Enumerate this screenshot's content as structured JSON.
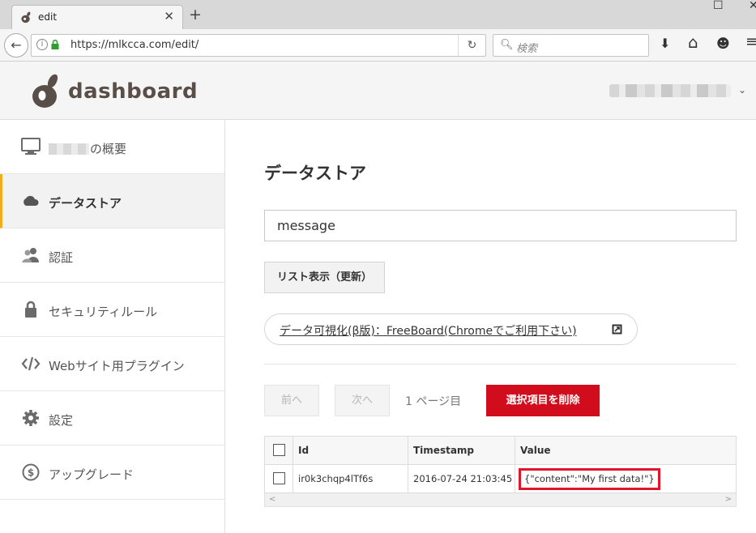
{
  "browser": {
    "tab_title": "edit",
    "tab_close": "✕",
    "new_tab": "+",
    "back": "←",
    "info": "i",
    "url": "https://mlkcca.com/edit/",
    "reload": "↻",
    "search_icon": "🔍︎",
    "search_placeholder": "検索",
    "download_icon": "⬇",
    "home_icon": "⌂",
    "emoji_icon": "☻",
    "menu_icon": "≡",
    "maximize": "☐",
    "close": "✕"
  },
  "header": {
    "brand": "dashboard",
    "account_caret": "⌄"
  },
  "sidebar": {
    "items": [
      {
        "label": "の概要",
        "icon": "monitor-icon"
      },
      {
        "label": "データストア",
        "icon": "cloud-icon"
      },
      {
        "label": "認証",
        "icon": "users-icon"
      },
      {
        "label": "セキュリティルール",
        "icon": "lock-icon"
      },
      {
        "label": "Webサイト用プラグイン",
        "icon": "code-icon"
      },
      {
        "label": "設定",
        "icon": "gear-icon"
      },
      {
        "label": "アップグレード",
        "icon": "dollar-icon"
      }
    ]
  },
  "main": {
    "title": "データストア",
    "datastore_value": "message",
    "list_button": "リスト表示（更新）",
    "viz_link": "データ可視化(β版)：FreeBoard(Chromeでご利用下さい)",
    "prev_button": "前へ",
    "next_button": "次へ",
    "page_info": "1 ページ目",
    "delete_button": "選択項目を削除",
    "table": {
      "columns": [
        "Id",
        "Timestamp",
        "Value"
      ],
      "rows": [
        {
          "id": "ir0k3chqp4lTf6s",
          "timestamp": "2016-07-24 21:03:45",
          "value": "{\"content\":\"My first data!\"}"
        }
      ]
    },
    "scroll_left": "<",
    "scroll_right": ">"
  },
  "colors": {
    "accent": "#f0ad1c",
    "brand": "#5a4e49",
    "delete": "#d10c1c",
    "highlight": "#e1162a"
  }
}
